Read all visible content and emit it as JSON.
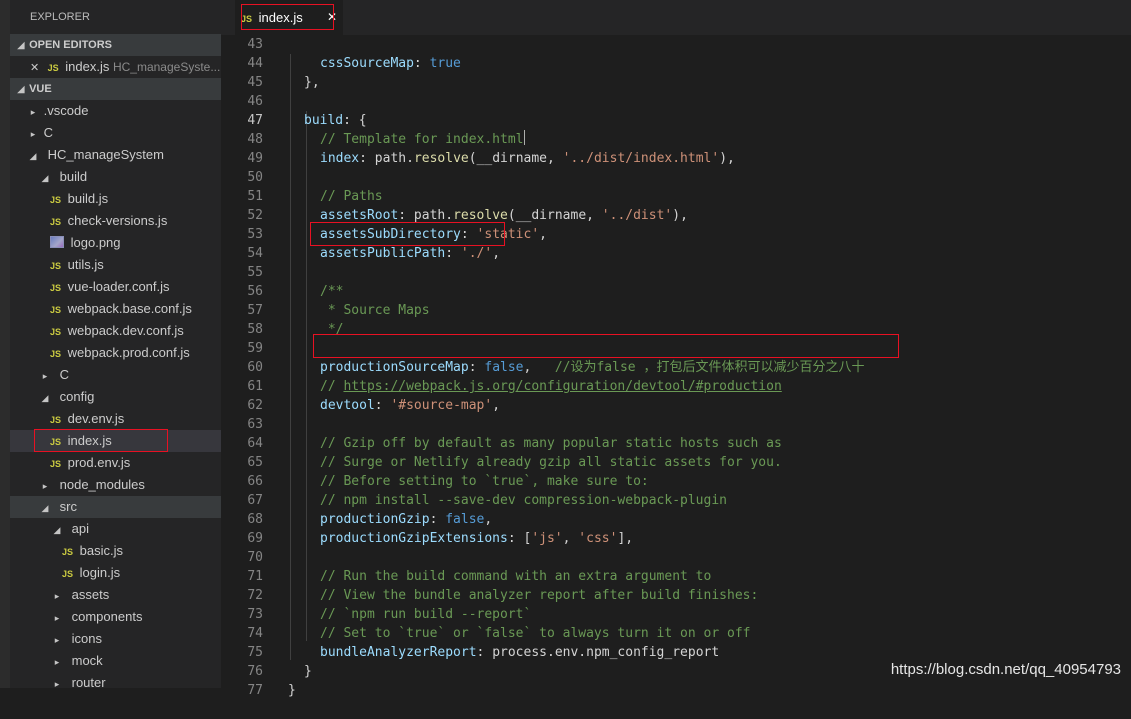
{
  "explorer": {
    "title": "EXPLORER",
    "open_editors_label": "OPEN EDITORS",
    "open_editor_file": "index.js",
    "open_editor_path": "HC_manageSyste...",
    "folder_label": "VUE"
  },
  "tree": {
    "vscode": ".vscode",
    "c_top": "C",
    "hc": "HC_manageSystem",
    "build": "build",
    "build_js": "build.js",
    "check_versions": "check-versions.js",
    "logo": "logo.png",
    "utils": "utils.js",
    "vue_loader": "vue-loader.conf.js",
    "wp_base": "webpack.base.conf.js",
    "wp_dev": "webpack.dev.conf.js",
    "wp_prod": "webpack.prod.conf.js",
    "c_inner": "C",
    "config": "config",
    "dev_env": "dev.env.js",
    "index_js": "index.js",
    "prod_env": "prod.env.js",
    "node_modules": "node_modules",
    "src": "src",
    "api": "api",
    "basic": "basic.js",
    "login": "login.js",
    "assets": "assets",
    "components": "components",
    "icons": "icons",
    "mock": "mock",
    "router": "router"
  },
  "tab": {
    "icon": "JS",
    "label": "index.js",
    "close": "✕"
  },
  "icons": {
    "js": "JS",
    "collapsed": "▸",
    "expanded": "◢"
  },
  "code": {
    "l43": "cssSourceMap",
    "l43v": "true",
    "l44": "},",
    "l46": "build",
    "l46b": ": {",
    "l47": "// Template for index.html",
    "l48a": "index",
    "l48b": ": path.",
    "l48c": "resolve",
    "l48d": "(__dirname, ",
    "l48e": "'../dist/index.html'",
    "l48f": "),",
    "l50": "// Paths",
    "l51a": "assetsRoot",
    "l51b": ": path.",
    "l51c": "resolve",
    "l51d": "(__dirname, ",
    "l51e": "'../dist'",
    "l51f": "),",
    "l52a": "assetsSubDirectory",
    "l52b": ": ",
    "l52c": "'static'",
    "l52d": ",",
    "l53a": "assetsPublicPath",
    "l53b": ": ",
    "l53c": "'./'",
    "l53d": ",",
    "l55": "/**",
    "l56": " * Source Maps",
    "l57": " */",
    "l59a": "productionSourceMap",
    "l59b": ": ",
    "l59c": "false",
    "l59d": ",   ",
    "l59e": "//设为false ，打包后文件体积可以减少百分之八十",
    "l60a": "// ",
    "l60b": "https://webpack.js.org/configuration/devtool/#production",
    "l61a": "devtool",
    "l61b": ": ",
    "l61c": "'#source-map'",
    "l61d": ",",
    "l63": "// Gzip off by default as many popular static hosts such as",
    "l64": "// Surge or Netlify already gzip all static assets for you.",
    "l65": "// Before setting to `true`, make sure to:",
    "l66": "// npm install --save-dev compression-webpack-plugin",
    "l67a": "productionGzip",
    "l67b": ": ",
    "l67c": "false",
    "l67d": ",",
    "l68a": "productionGzipExtensions",
    "l68b": ": [",
    "l68c": "'js'",
    "l68d": ", ",
    "l68e": "'css'",
    "l68f": "],",
    "l70": "// Run the build command with an extra argument to",
    "l71": "// View the bundle analyzer report after build finishes:",
    "l72": "// `npm run build --report`",
    "l73": "// Set to `true` or `false` to always turn it on or off",
    "l74a": "bundleAnalyzerReport",
    "l74b": ": process.env.npm_config_report",
    "l75": "}",
    "l76": "}"
  },
  "line_numbers": [
    "43",
    "44",
    "45",
    "46",
    "47",
    "48",
    "49",
    "50",
    "51",
    "52",
    "53",
    "54",
    "55",
    "56",
    "57",
    "58",
    "59",
    "60",
    "61",
    "62",
    "63",
    "64",
    "65",
    "66",
    "67",
    "68",
    "69",
    "70",
    "71",
    "72",
    "73",
    "74",
    "75",
    "76",
    "77"
  ],
  "active_line": "47",
  "watermark": "https://blog.csdn.net/qq_40954793",
  "colors": {
    "highlight_box": "#e81123",
    "comment": "#6a9955",
    "property": "#9cdcfe",
    "string": "#ce9178",
    "keyword": "#569cd6"
  }
}
